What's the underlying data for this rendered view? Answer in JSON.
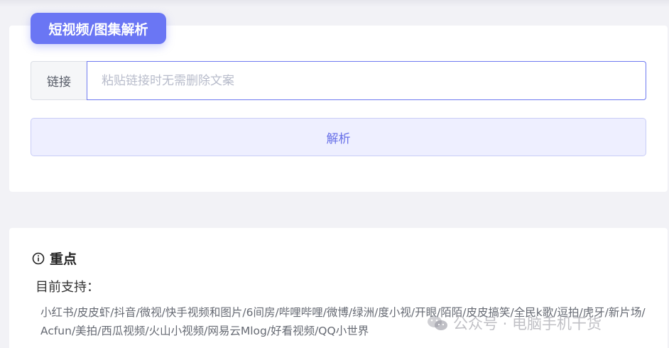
{
  "header": {
    "badge_label": "短视频/图集解析"
  },
  "form": {
    "prefix_label": "链接",
    "input_value": "",
    "input_placeholder": "粘贴链接时无需删除文案",
    "parse_button_label": "解析"
  },
  "notes": {
    "title": "重点",
    "support_title": "目前支持：",
    "platforms_text": "小红书/皮皮虾/抖音/微视/快手视频和图片/6间房/哔哩哔哩/微博/绿洲/度小视/开眼/陌陌/皮皮搞笑/全民k歌/逗拍/虎牙/新片场/Acfun/美拍/西瓜视频/火山小视频/网易云Mlog/好看视频/QQ小世界"
  },
  "watermark": {
    "text": "公众号 · 电脑手机干货"
  },
  "colors": {
    "accent": "#6a76f4",
    "button_bg": "#eeefff",
    "button_text": "#6870e8",
    "page_bg": "#f2f2f6"
  },
  "icons": {
    "section_icon": "info-circle-icon",
    "watermark_icon": "wechat-icon"
  }
}
